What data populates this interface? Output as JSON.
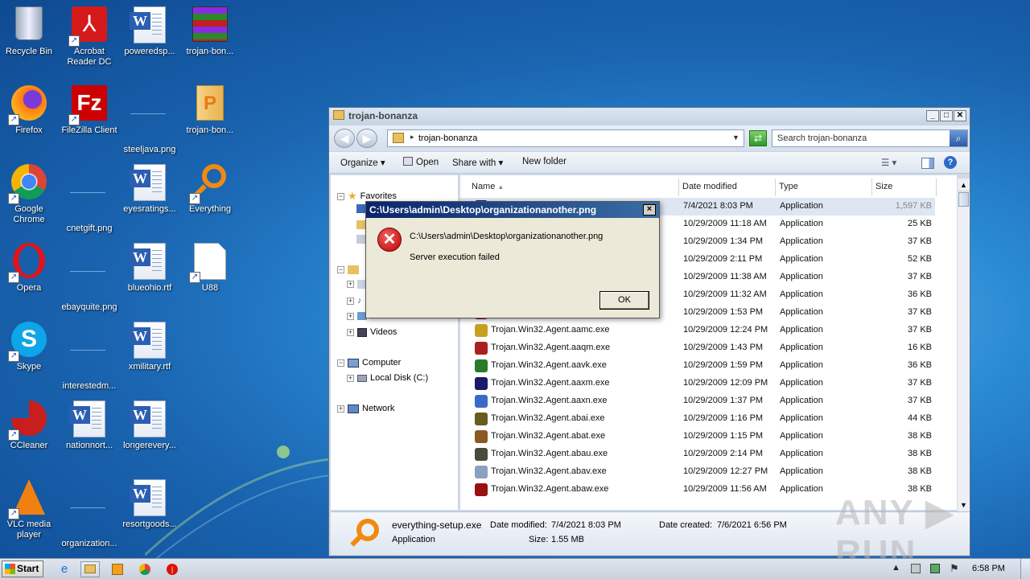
{
  "desktop": {
    "icons": [
      {
        "label": "Recycle Bin",
        "icon": "recycle-bin-icon"
      },
      {
        "label": "Acrobat Reader DC",
        "icon": "acrobat-icon"
      },
      {
        "label": "poweredsp...",
        "icon": "word-doc-icon"
      },
      {
        "label": "trojan-bon...",
        "icon": "winrar-icon"
      },
      {
        "label": "Firefox",
        "icon": "firefox-icon"
      },
      {
        "label": "FileZilla Client",
        "icon": "filezilla-icon"
      },
      {
        "label": "steeljava.png",
        "icon": "png-file-icon"
      },
      {
        "label": "trojan-bon...",
        "icon": "folder-icon"
      },
      {
        "label": "Google Chrome",
        "icon": "chrome-icon"
      },
      {
        "label": "cnetgift.png",
        "icon": "png-file-icon"
      },
      {
        "label": "eyesratings...",
        "icon": "word-doc-icon"
      },
      {
        "label": "Everything",
        "icon": "everything-icon"
      },
      {
        "label": "Opera",
        "icon": "opera-icon"
      },
      {
        "label": "ebayquite.png",
        "icon": "png-file-icon"
      },
      {
        "label": "blueohio.rtf",
        "icon": "word-doc-icon"
      },
      {
        "label": "U88",
        "icon": "blank-file-icon"
      },
      {
        "label": "Skype",
        "icon": "skype-icon"
      },
      {
        "label": "interestedm...",
        "icon": "png-file-icon"
      },
      {
        "label": "xmilitary.rtf",
        "icon": "word-doc-icon"
      },
      {
        "label": "CCleaner",
        "icon": "ccleaner-icon"
      },
      {
        "label": "nationnort...",
        "icon": "word-doc-icon"
      },
      {
        "label": "longerevery...",
        "icon": "word-doc-icon"
      },
      {
        "label": "VLC media player",
        "icon": "vlc-icon"
      },
      {
        "label": "organization...",
        "icon": "png-file-icon"
      },
      {
        "label": "resortgoods...",
        "icon": "word-doc-icon"
      }
    ]
  },
  "explorer": {
    "title": "trojan-bonanza",
    "breadcrumb": "trojan-bonanza",
    "search_placeholder": "Search trojan-bonanza",
    "toolbar": {
      "organize": "Organize",
      "open": "Open",
      "share_with": "Share with",
      "new_folder": "New folder"
    },
    "nav": {
      "favorites": "Favorites",
      "videos": "Videos",
      "computer": "Computer",
      "local_disk": "Local Disk (C:)",
      "network": "Network"
    },
    "columns": {
      "name": "Name",
      "date": "Date modified",
      "type": "Type",
      "size": "Size"
    },
    "rows": [
      {
        "name": "",
        "date": "7/4/2021 8:03 PM",
        "type": "Application",
        "size": "1,597 KB"
      },
      {
        "name": "",
        "date": "10/29/2009 11:18 AM",
        "type": "Application",
        "size": "25 KB"
      },
      {
        "name": "",
        "date": "10/29/2009 1:34 PM",
        "type": "Application",
        "size": "37 KB"
      },
      {
        "name": "",
        "date": "10/29/2009 2:11 PM",
        "type": "Application",
        "size": "52 KB"
      },
      {
        "name": "",
        "date": "10/29/2009 11:38 AM",
        "type": "Application",
        "size": "37 KB"
      },
      {
        "name": "",
        "date": "10/29/2009 11:32 AM",
        "type": "Application",
        "size": "36 KB"
      },
      {
        "name": "",
        "date": "10/29/2009 1:53 PM",
        "type": "Application",
        "size": "37 KB"
      },
      {
        "name": "Trojan.Win32.Agent.aamc.exe",
        "date": "10/29/2009 12:24 PM",
        "type": "Application",
        "size": "37 KB"
      },
      {
        "name": "Trojan.Win32.Agent.aaqm.exe",
        "date": "10/29/2009 1:43 PM",
        "type": "Application",
        "size": "16 KB"
      },
      {
        "name": "Trojan.Win32.Agent.aavk.exe",
        "date": "10/29/2009 1:59 PM",
        "type": "Application",
        "size": "36 KB"
      },
      {
        "name": "Trojan.Win32.Agent.aaxm.exe",
        "date": "10/29/2009 12:09 PM",
        "type": "Application",
        "size": "37 KB"
      },
      {
        "name": "Trojan.Win32.Agent.aaxn.exe",
        "date": "10/29/2009 1:37 PM",
        "type": "Application",
        "size": "37 KB"
      },
      {
        "name": "Trojan.Win32.Agent.abai.exe",
        "date": "10/29/2009 1:16 PM",
        "type": "Application",
        "size": "44 KB"
      },
      {
        "name": "Trojan.Win32.Agent.abat.exe",
        "date": "10/29/2009 1:15 PM",
        "type": "Application",
        "size": "38 KB"
      },
      {
        "name": "Trojan.Win32.Agent.abau.exe",
        "date": "10/29/2009 2:14 PM",
        "type": "Application",
        "size": "38 KB"
      },
      {
        "name": "Trojan.Win32.Agent.abav.exe",
        "date": "10/29/2009 12:27 PM",
        "type": "Application",
        "size": "38 KB"
      },
      {
        "name": "Trojan.Win32.Agent.abaw.exe",
        "date": "10/29/2009 11:56 AM",
        "type": "Application",
        "size": "38 KB"
      }
    ],
    "details": {
      "file_name": "everything-setup.exe",
      "file_type": "Application",
      "date_modified_label": "Date modified:",
      "date_modified": "7/4/2021 8:03 PM",
      "date_created_label": "Date created:",
      "date_created": "7/6/2021 6:56 PM",
      "size_label": "Size:",
      "size": "1.55 MB"
    }
  },
  "dialog": {
    "title": "C:\\Users\\admin\\Desktop\\organizationanother.png",
    "path": "C:\\Users\\admin\\Desktop\\organizationanother.png",
    "message": "Server execution failed",
    "ok": "OK",
    "close": "×"
  },
  "taskbar": {
    "start": "Start",
    "clock": "6:58 PM"
  },
  "watermark": "ANY ▶ RUN"
}
